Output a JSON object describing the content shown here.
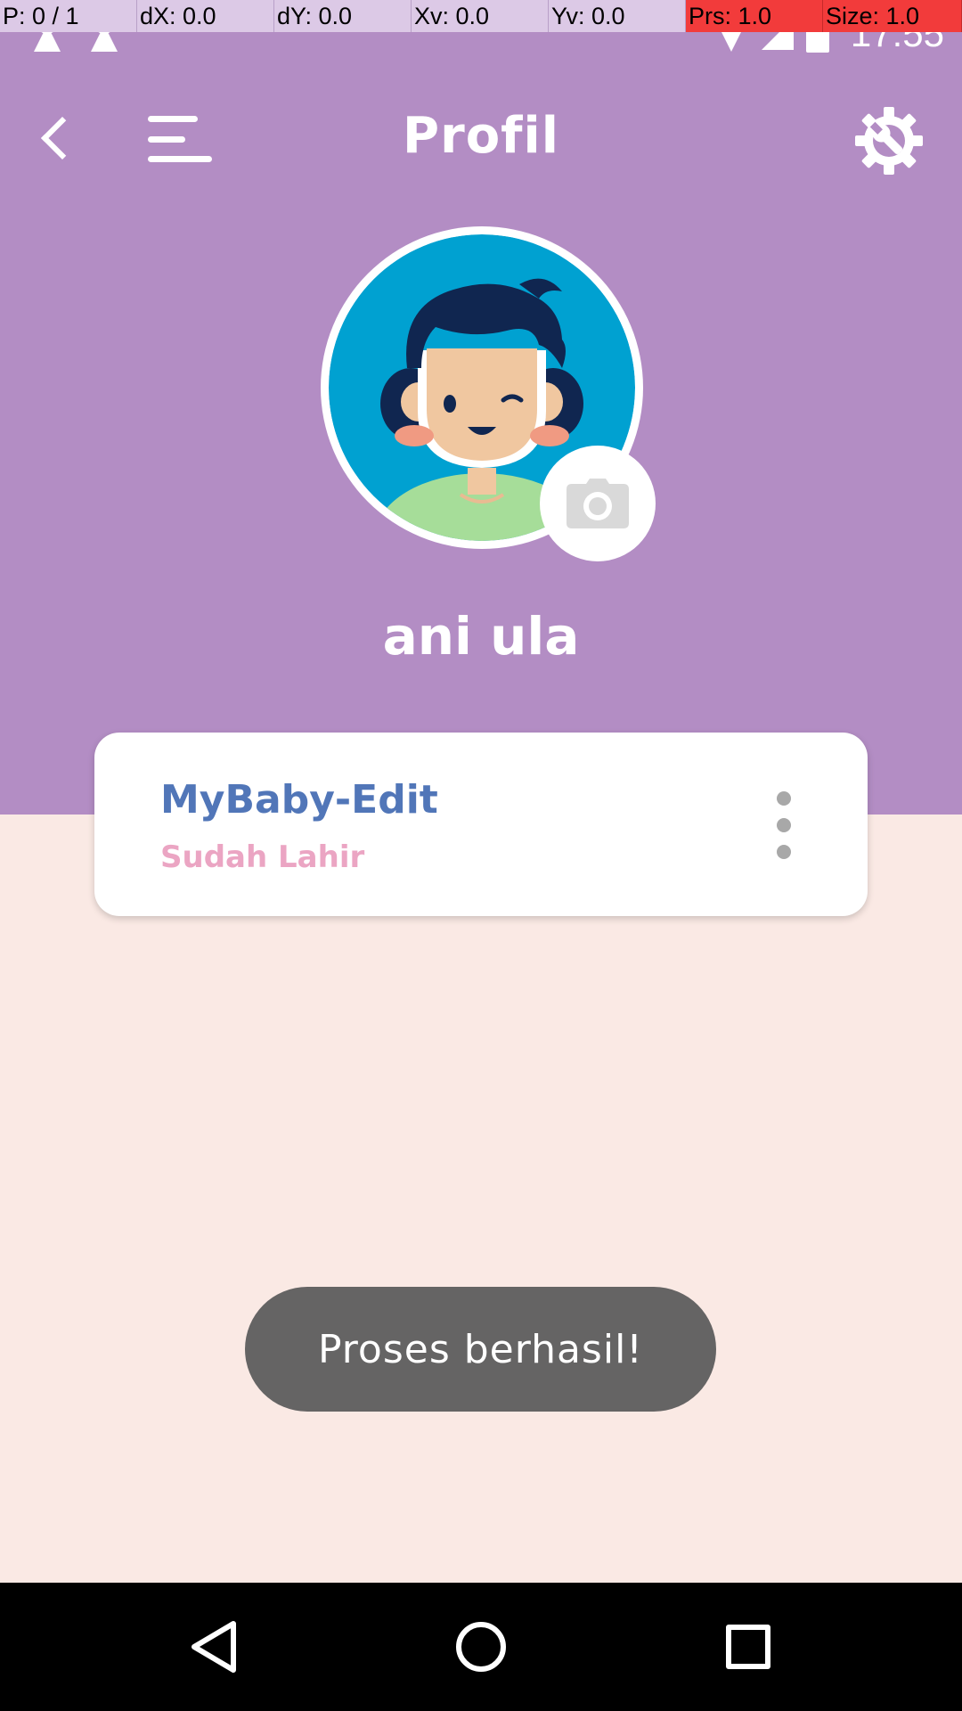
{
  "debug_overlay": {
    "pointer": "P: 0 / 1",
    "dx": "dX: 0.0",
    "dy": "dY: 0.0",
    "xv": "Xv: 0.0",
    "yv": "Yv: 0.0",
    "prs": "Prs: 1.0",
    "size": "Size: 1.0"
  },
  "status_bar": {
    "time": "17:55",
    "icons": [
      "keyhole-icon",
      "keyhole-icon",
      "wifi-icon",
      "signal-icon",
      "battery-icon"
    ]
  },
  "toolbar": {
    "title": "Profil",
    "back_icon": "back-arrow-icon",
    "menu_icon": "hamburger-menu-icon",
    "settings_icon": "settings-wrench-gear-icon"
  },
  "profile": {
    "name": "ani ula",
    "avatar": "boy-avatar",
    "camera_icon": "camera-icon"
  },
  "baby_card": {
    "name": "MyBaby-Edit",
    "status": "Sudah Lahir",
    "more_icon": "more-vertical-icon"
  },
  "toast": {
    "message": "Proses berhasil!"
  },
  "colors": {
    "header": "#b38dc4",
    "background": "#fae9e4",
    "baby_name": "#5176b8",
    "baby_status": "#eba5c3",
    "toast": "#656464"
  },
  "nav_bar": {
    "icons": [
      "back-triangle-icon",
      "home-circle-icon",
      "recents-square-icon"
    ]
  }
}
